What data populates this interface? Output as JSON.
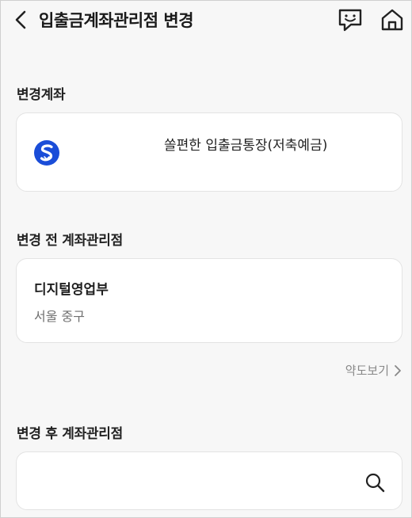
{
  "header": {
    "title": "입출금계좌관리점 변경",
    "back_icon": "chevron-left-icon",
    "chat_icon": "chat-icon",
    "home_icon": "home-icon"
  },
  "change_account": {
    "label": "변경계좌",
    "account_name": "쏠편한 입출금통장(저축예금)",
    "logo_icon": "bank-logo-icon"
  },
  "before_branch": {
    "label": "변경 전 계좌관리점",
    "name": "디지털영업부",
    "address": "서울 중구"
  },
  "map_link": {
    "label": "약도보기",
    "icon": "chevron-right-icon"
  },
  "after_branch": {
    "label": "변경 후 계좌관리점",
    "search_value": "",
    "search_placeholder": "",
    "search_icon": "search-icon"
  },
  "colors": {
    "background": "#f7f7f7",
    "card": "#ffffff",
    "brand_blue": "#1a4dd8",
    "muted_text": "#707070"
  }
}
